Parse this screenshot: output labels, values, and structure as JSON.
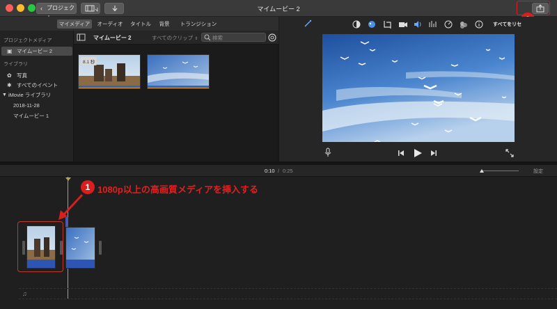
{
  "window": {
    "title": "マイムービー 2",
    "back_button": "プロジェクト"
  },
  "browser_tabs": [
    "マイメディア",
    "オーディオ",
    "タイトル",
    "背景",
    "トランジション"
  ],
  "sidebar": {
    "project_media_header": "プロジェクトメディア",
    "project_item": "マイムービー 2",
    "libraries_header": "ライブラリ",
    "photos": "写真",
    "all_events": "すべてのイベント",
    "imovie_library": "iMovie ライブラリ",
    "event_date": "2018-11-28",
    "event_movie": "マイムービー 1"
  },
  "media_browser": {
    "title": "マイムービー 2",
    "filter": "すべてのクリップ",
    "search_placeholder": "検索",
    "clip1_duration": "8.1 秒"
  },
  "viewer": {
    "reset_all": "すべてをリセ"
  },
  "timebar": {
    "current": "0:10",
    "separator": "/",
    "total": "0:25",
    "settings": "設定"
  },
  "annotations": {
    "step1_number": "1",
    "step1_text": "1080p以上の高画質メディアを挿入する",
    "step2_number": "2"
  },
  "icons": {
    "audio_track": "♫"
  },
  "colors": {
    "annotation_red": "#d91e1e",
    "selection_red": "#c0392b",
    "playhead": "#b8a24a"
  }
}
